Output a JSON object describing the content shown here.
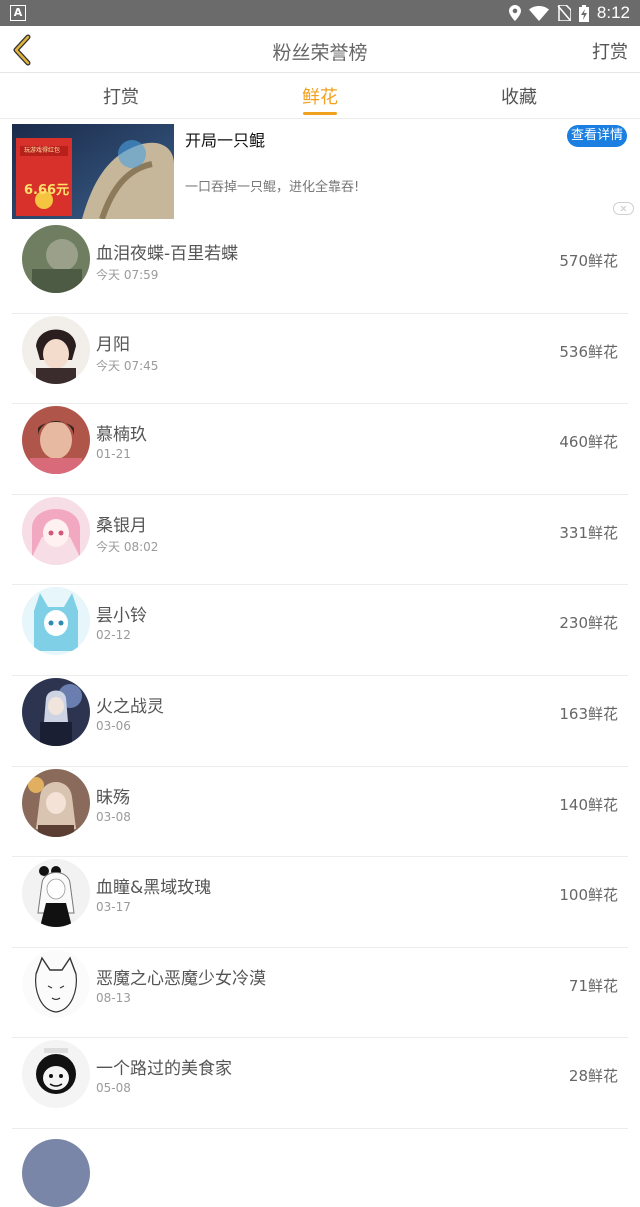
{
  "status_bar": {
    "time": "8:12"
  },
  "header": {
    "title": "粉丝荣誉榜",
    "action": "打赏"
  },
  "tabs": [
    {
      "label": "打赏"
    },
    {
      "label": "鲜花"
    },
    {
      "label": "收藏"
    }
  ],
  "active_tab": "鲜花",
  "ad": {
    "title": "开局一只鲲",
    "description": "一口吞掉一只鲲，进化全靠吞!",
    "button": "查看详情",
    "image_text": {
      "caption": "玩游戏得红包",
      "amount": "6.66元"
    }
  },
  "ranking": [
    {
      "name": "血泪夜蝶-百里若蝶",
      "time": "今天 07:59",
      "count": "570鲜花",
      "avatar_color": "#6f7e60"
    },
    {
      "name": "月阳",
      "time": "今天 07:45",
      "count": "536鲜花",
      "avatar_color": "#3a2c2c"
    },
    {
      "name": "慕楠玖",
      "time": "01-21",
      "count": "460鲜花",
      "avatar_color": "#b0554a"
    },
    {
      "name": "桑银月",
      "time": "今天 08:02",
      "count": "331鲜花",
      "avatar_color": "#f2b8c8"
    },
    {
      "name": "昙小铃",
      "time": "02-12",
      "count": "230鲜花",
      "avatar_color": "#7fd0e6"
    },
    {
      "name": "火之战灵",
      "time": "03-06",
      "count": "163鲜花",
      "avatar_color": "#2d3450"
    },
    {
      "name": "昧殇",
      "time": "03-08",
      "count": "140鲜花",
      "avatar_color": "#8a6a5a"
    },
    {
      "name": "血瞳&黑域玫瑰",
      "time": "03-17",
      "count": "100鲜花",
      "avatar_color": "#eaeaea"
    },
    {
      "name": "恶魔之心恶魔少女冷漠",
      "time": "08-13",
      "count": "71鲜花",
      "avatar_color": "#f4f4f4"
    },
    {
      "name": "一个路过的美食家",
      "time": "05-08",
      "count": "28鲜花",
      "avatar_color": "#f0f0f0"
    }
  ],
  "colors": {
    "accent": "#f2a11f",
    "ad_button": "#1a7fe0",
    "status_bar": "#6b6b6b"
  }
}
